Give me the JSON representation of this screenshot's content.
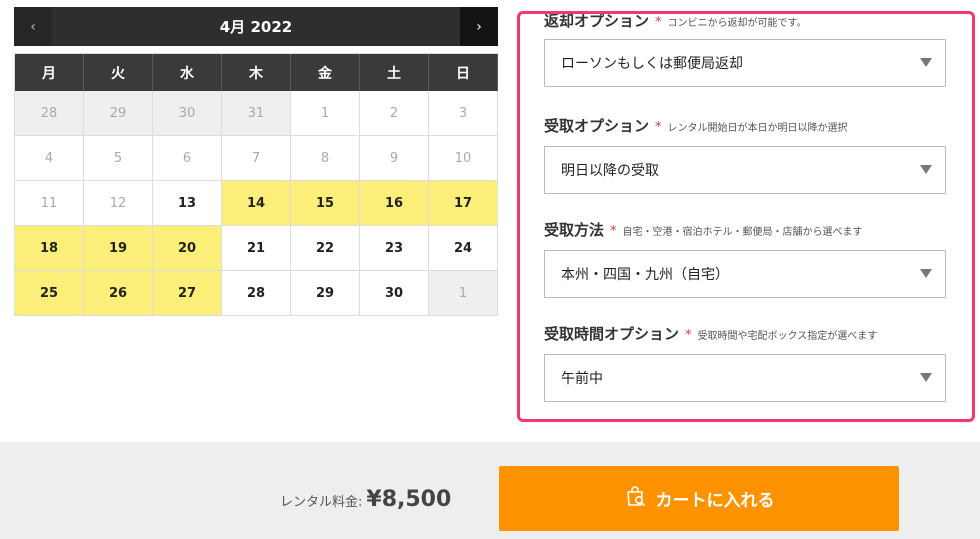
{
  "calendar": {
    "prev_icon": "‹",
    "next_icon": "›",
    "title": "4月 2022",
    "weekdays": [
      "月",
      "火",
      "水",
      "木",
      "金",
      "土",
      "日"
    ],
    "weeks": [
      [
        {
          "d": "28",
          "s": "other"
        },
        {
          "d": "29",
          "s": "other"
        },
        {
          "d": "30",
          "s": "other"
        },
        {
          "d": "31",
          "s": "other"
        },
        {
          "d": "1",
          "s": "disabled"
        },
        {
          "d": "2",
          "s": "disabled"
        },
        {
          "d": "3",
          "s": "disabled"
        }
      ],
      [
        {
          "d": "4",
          "s": "disabled"
        },
        {
          "d": "5",
          "s": "disabled"
        },
        {
          "d": "6",
          "s": "disabled"
        },
        {
          "d": "7",
          "s": "disabled"
        },
        {
          "d": "8",
          "s": "disabled"
        },
        {
          "d": "9",
          "s": "disabled"
        },
        {
          "d": "10",
          "s": "disabled"
        }
      ],
      [
        {
          "d": "11",
          "s": "disabled"
        },
        {
          "d": "12",
          "s": "disabled"
        },
        {
          "d": "13",
          "s": "avail"
        },
        {
          "d": "14",
          "s": "hl"
        },
        {
          "d": "15",
          "s": "hl"
        },
        {
          "d": "16",
          "s": "hl"
        },
        {
          "d": "17",
          "s": "hl"
        }
      ],
      [
        {
          "d": "18",
          "s": "hl"
        },
        {
          "d": "19",
          "s": "hl"
        },
        {
          "d": "20",
          "s": "hl"
        },
        {
          "d": "21",
          "s": "avail"
        },
        {
          "d": "22",
          "s": "avail"
        },
        {
          "d": "23",
          "s": "avail"
        },
        {
          "d": "24",
          "s": "avail"
        }
      ],
      [
        {
          "d": "25",
          "s": "hl"
        },
        {
          "d": "26",
          "s": "hl"
        },
        {
          "d": "27",
          "s": "hl"
        },
        {
          "d": "28",
          "s": "avail"
        },
        {
          "d": "29",
          "s": "avail"
        },
        {
          "d": "30",
          "s": "avail"
        },
        {
          "d": "1",
          "s": "other"
        }
      ]
    ]
  },
  "options": {
    "return": {
      "title": "返却オプション",
      "required": "*",
      "note": "コンビニから返却が可能です。",
      "value": "ローソンもしくは郵便局返却"
    },
    "pickup": {
      "title": "受取オプション",
      "required": "*",
      "note": "レンタル開始日が本日か明日以降か選択",
      "value": "明日以降の受取"
    },
    "method": {
      "title": "受取方法",
      "required": "*",
      "note": "自宅・空港・宿泊ホテル・郵便局・店舗から選べます",
      "value": "本州・四国・九州（自宅）"
    },
    "time": {
      "title": "受取時間オプション",
      "required": "*",
      "note": "受取時間や宅配ボックス指定が選べます",
      "value": "午前中"
    }
  },
  "footer": {
    "price_label": "レンタル料金:",
    "price_value": "¥8,500",
    "cart_label": "カートに入れる",
    "cart_icon": "shopping-bag-search-icon"
  },
  "colors": {
    "highlight": "#fbef79",
    "accent_border": "#ee3a6c",
    "cart_button": "#ff9200"
  }
}
